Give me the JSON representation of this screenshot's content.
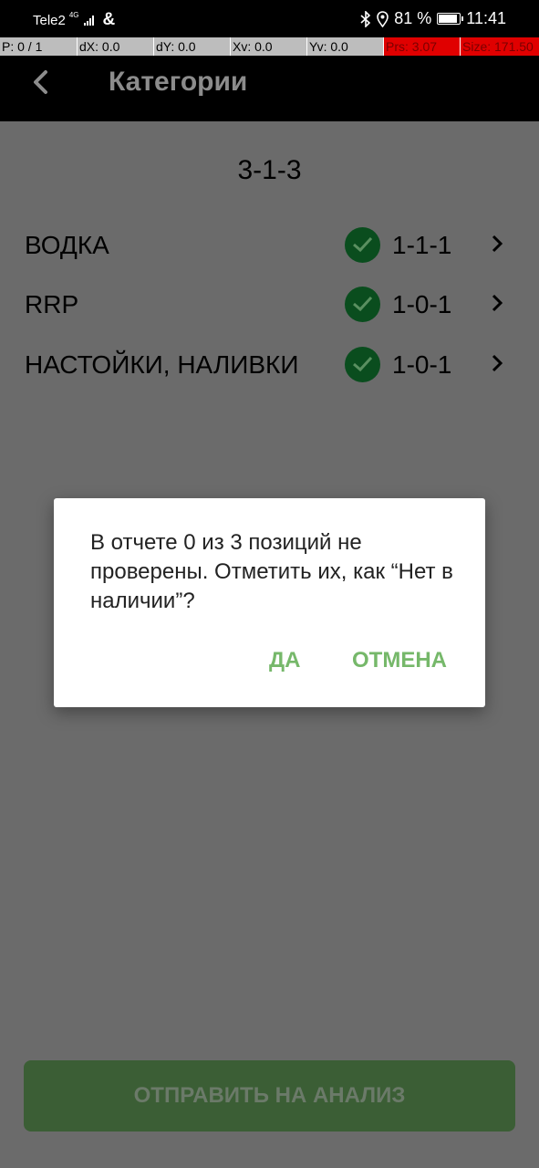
{
  "status_bar": {
    "carrier": "Tele2",
    "network": "4G",
    "extra": "&",
    "battery_percent": "81 %",
    "battery_level": 0.81,
    "time": "11:41"
  },
  "debug_bar": {
    "p": "P: 0 / 1",
    "dx": "dX: 0.0",
    "dy": "dY: 0.0",
    "xv": "Xv: 0.0",
    "yv": "Yv: 0.0",
    "prs": "Prs: 3.07",
    "size": "Size: 171.50"
  },
  "header": {
    "title": "Категории"
  },
  "summary": "3-1-3",
  "categories": [
    {
      "name": "ВОДКА",
      "value": "1-1-1"
    },
    {
      "name": "RRP",
      "value": "1-0-1"
    },
    {
      "name": "НАСТОЙКИ, НАЛИВКИ",
      "value": "1-0-1"
    }
  ],
  "dialog": {
    "message": "В отчете 0 из 3 позиций не проверены. Отметить их, как “Нет в наличии”?",
    "yes_label": "ДА",
    "cancel_label": "ОТМЕНА"
  },
  "footer": {
    "send_label": "ОТПРАВИТЬ НА АНАЛИЗ"
  },
  "colors": {
    "overlay": "#6b6b6b",
    "check_bg": "#0a4d1e",
    "dialog_button": "#76b86a",
    "send_button": "#3b5e35"
  }
}
